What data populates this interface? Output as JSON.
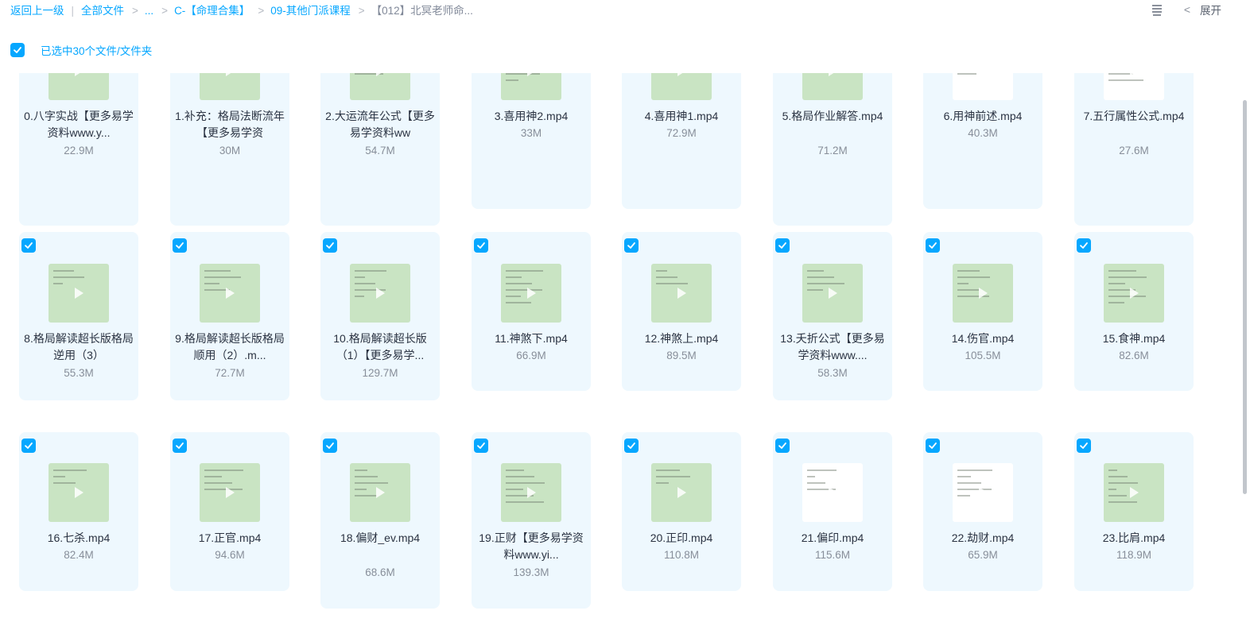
{
  "breadcrumb": {
    "back": "返回上一级",
    "all_files": "全部文件",
    "ellipsis": "...",
    "item1": "C-【命理合集】",
    "item2": "09-其他门派课程",
    "item3": "【012】北冥老师命..."
  },
  "top_right": {
    "expand": "展开"
  },
  "selection": {
    "text": "已选中30个文件/文件夹"
  },
  "files": [
    {
      "name": "0.八字实战【更多易学资料www.y...",
      "size": "22.9M",
      "checked": true
    },
    {
      "name": "1.补充：格局法断流年【更多易学资",
      "size": "30M",
      "checked": true
    },
    {
      "name": "2.大运流年公式【更多易学资料ww",
      "size": "54.7M",
      "checked": true
    },
    {
      "name": "3.喜用神2.mp4",
      "size": "33M",
      "checked": true
    },
    {
      "name": "4.喜用神1.mp4",
      "size": "72.9M",
      "checked": true
    },
    {
      "name": "5.格局作业解答.mp4",
      "size": "71.2M",
      "checked": true
    },
    {
      "name": "6.用神前述.mp4",
      "size": "40.3M",
      "checked": true
    },
    {
      "name": "7.五行属性公式.mp4",
      "size": "27.6M",
      "checked": true
    },
    {
      "name": "8.格局解读超长版格局逆用（3）",
      "size": "55.3M",
      "checked": true
    },
    {
      "name": "9.格局解读超长版格局顺用（2）.m...",
      "size": "72.7M",
      "checked": true
    },
    {
      "name": "10.格局解读超长版（1）【更多易学...",
      "size": "129.7M",
      "checked": true
    },
    {
      "name": "11.神煞下.mp4",
      "size": "66.9M",
      "checked": true
    },
    {
      "name": "12.神煞上.mp4",
      "size": "89.5M",
      "checked": true
    },
    {
      "name": "13.夭折公式【更多易学资料www....",
      "size": "58.3M",
      "checked": true
    },
    {
      "name": "14.伤官.mp4",
      "size": "105.5M",
      "checked": true
    },
    {
      "name": "15.食神.mp4",
      "size": "82.6M",
      "checked": true
    },
    {
      "name": "16.七杀.mp4",
      "size": "82.4M",
      "checked": true
    },
    {
      "name": "17.正官.mp4",
      "size": "94.6M",
      "checked": true
    },
    {
      "name": "18.偏财_ev.mp4",
      "size": "68.6M",
      "checked": true
    },
    {
      "name": "19.正财【更多易学资料www.yi...",
      "size": "139.3M",
      "checked": true
    },
    {
      "name": "20.正印.mp4",
      "size": "110.8M",
      "checked": true
    },
    {
      "name": "21.偏印.mp4",
      "size": "115.6M",
      "checked": true
    },
    {
      "name": "22.劫财.mp4",
      "size": "65.9M",
      "checked": true
    },
    {
      "name": "23.比肩.mp4",
      "size": "118.9M",
      "checked": true
    }
  ],
  "colors": {
    "accent": "#06a7ff",
    "card_bg": "#eef8fe",
    "thumb_green": "#c9e4c3"
  }
}
